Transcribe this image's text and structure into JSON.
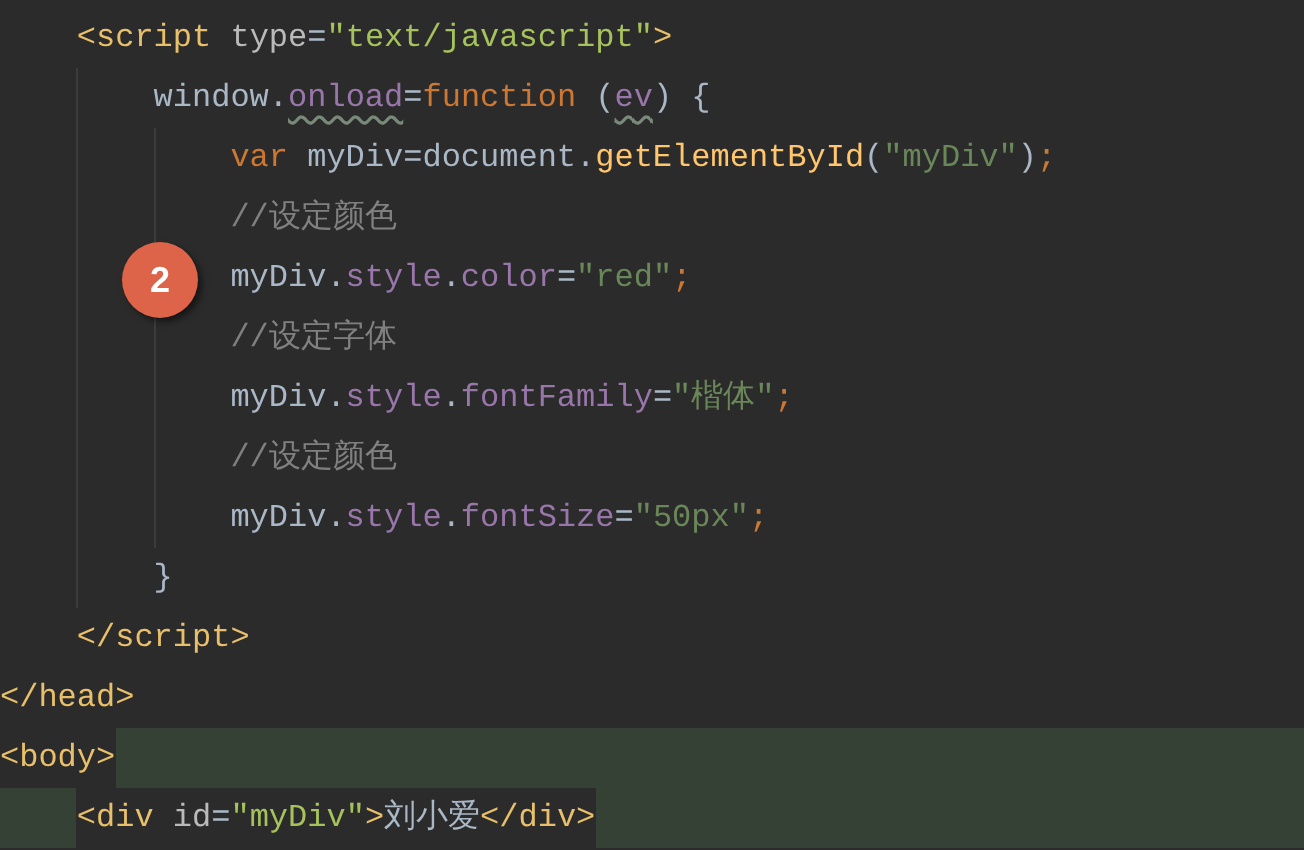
{
  "code": [
    {
      "children": [
        {
          "tokens": [
            {
              "text": "<script",
              "kind": "tag",
              "warning": false
            },
            {
              "text": " type",
              "kind": "attr",
              "warning": false
            },
            {
              "text": "=",
              "kind": "plain",
              "warning": false
            },
            {
              "text": "\"text/javascript\"",
              "kind": "attrvalue",
              "warning": false
            },
            {
              "text": ">",
              "kind": "tag",
              "warning": false
            }
          ],
          "highlighted": false,
          "children": [
            {
              "tokens": [
                {
                  "text": "window.",
                  "kind": "plain",
                  "warning": false
                },
                {
                  "text": "onload",
                  "kind": "field",
                  "warning": true
                },
                {
                  "text": "=",
                  "kind": "plain",
                  "warning": false
                },
                {
                  "text": "function",
                  "kind": "keyword",
                  "warning": false
                },
                {
                  "text": " (",
                  "kind": "plain",
                  "warning": false
                },
                {
                  "text": "ev",
                  "kind": "field",
                  "warning": true
                },
                {
                  "text": ") {",
                  "kind": "plain",
                  "warning": false
                }
              ],
              "highlighted": false,
              "children": [
                {
                  "tokens": [
                    {
                      "text": "var",
                      "kind": "keyword",
                      "warning": false
                    },
                    {
                      "text": " myDiv=document.",
                      "kind": "plain",
                      "warning": false
                    },
                    {
                      "text": "getElementById",
                      "kind": "method",
                      "warning": false
                    },
                    {
                      "text": "(",
                      "kind": "plain",
                      "warning": false
                    },
                    {
                      "text": "\"myDiv\"",
                      "kind": "string",
                      "warning": false
                    },
                    {
                      "text": ")",
                      "kind": "plain",
                      "warning": false
                    },
                    {
                      "text": ";",
                      "kind": "keyword",
                      "warning": false
                    }
                  ],
                  "highlighted": false
                },
                {
                  "tokens": [
                    {
                      "text": "//设定颜色",
                      "kind": "comment",
                      "warning": false
                    }
                  ],
                  "highlighted": false
                },
                {
                  "tokens": [
                    {
                      "text": "myDiv.",
                      "kind": "plain",
                      "warning": false
                    },
                    {
                      "text": "style",
                      "kind": "field",
                      "warning": false
                    },
                    {
                      "text": ".",
                      "kind": "plain",
                      "warning": false
                    },
                    {
                      "text": "color",
                      "kind": "field",
                      "warning": false
                    },
                    {
                      "text": "=",
                      "kind": "plain",
                      "warning": false
                    },
                    {
                      "text": "\"red\"",
                      "kind": "string",
                      "warning": false
                    },
                    {
                      "text": ";",
                      "kind": "keyword",
                      "warning": false
                    }
                  ],
                  "highlighted": false
                },
                {
                  "tokens": [
                    {
                      "text": "//设定字体",
                      "kind": "comment",
                      "warning": false
                    }
                  ],
                  "highlighted": false
                },
                {
                  "tokens": [
                    {
                      "text": "myDiv.",
                      "kind": "plain",
                      "warning": false
                    },
                    {
                      "text": "style",
                      "kind": "field",
                      "warning": false
                    },
                    {
                      "text": ".",
                      "kind": "plain",
                      "warning": false
                    },
                    {
                      "text": "fontFamily",
                      "kind": "field",
                      "warning": false
                    },
                    {
                      "text": "=",
                      "kind": "plain",
                      "warning": false
                    },
                    {
                      "text": "\"楷体\"",
                      "kind": "string",
                      "warning": false
                    },
                    {
                      "text": ";",
                      "kind": "keyword",
                      "warning": false
                    }
                  ],
                  "highlighted": false
                },
                {
                  "tokens": [
                    {
                      "text": "//设定颜色",
                      "kind": "comment",
                      "warning": false
                    }
                  ],
                  "highlighted": false
                },
                {
                  "tokens": [
                    {
                      "text": "myDiv.",
                      "kind": "plain",
                      "warning": false
                    },
                    {
                      "text": "style",
                      "kind": "field",
                      "warning": false
                    },
                    {
                      "text": ".",
                      "kind": "plain",
                      "warning": false
                    },
                    {
                      "text": "fontSize",
                      "kind": "field",
                      "warning": false
                    },
                    {
                      "text": "=",
                      "kind": "plain",
                      "warning": false
                    },
                    {
                      "text": "\"50px\"",
                      "kind": "string",
                      "warning": false
                    },
                    {
                      "text": ";",
                      "kind": "keyword",
                      "warning": false
                    }
                  ],
                  "highlighted": false
                }
              ]
            },
            {
              "tokens": [
                {
                  "text": "}",
                  "kind": "plain",
                  "warning": false
                }
              ],
              "highlighted": false
            }
          ]
        },
        {
          "tokens": [
            {
              "text": "</script>",
              "kind": "tag",
              "warning": false
            }
          ],
          "highlighted": false
        }
      ]
    },
    {
      "tokens": [
        {
          "text": "</head>",
          "kind": "tag",
          "warning": false
        }
      ],
      "highlighted": false
    },
    {
      "tokens": [
        {
          "text": "<body>",
          "kind": "tag",
          "warning": false
        }
      ],
      "highlighted": true,
      "children": [
        {
          "tokens": [
            {
              "text": "<div",
              "kind": "tag",
              "warning": false
            },
            {
              "text": " id",
              "kind": "attr",
              "warning": false
            },
            {
              "text": "=",
              "kind": "plain",
              "warning": false
            },
            {
              "text": "\"myDiv\"",
              "kind": "attrvalue",
              "warning": false
            },
            {
              "text": ">",
              "kind": "tag",
              "warning": false
            },
            {
              "text": "刘小爱",
              "kind": "plain",
              "warning": false
            },
            {
              "text": "</div>",
              "kind": "tag",
              "warning": false
            }
          ],
          "highlighted": true
        }
      ]
    }
  ],
  "badge": {
    "text": "2"
  }
}
